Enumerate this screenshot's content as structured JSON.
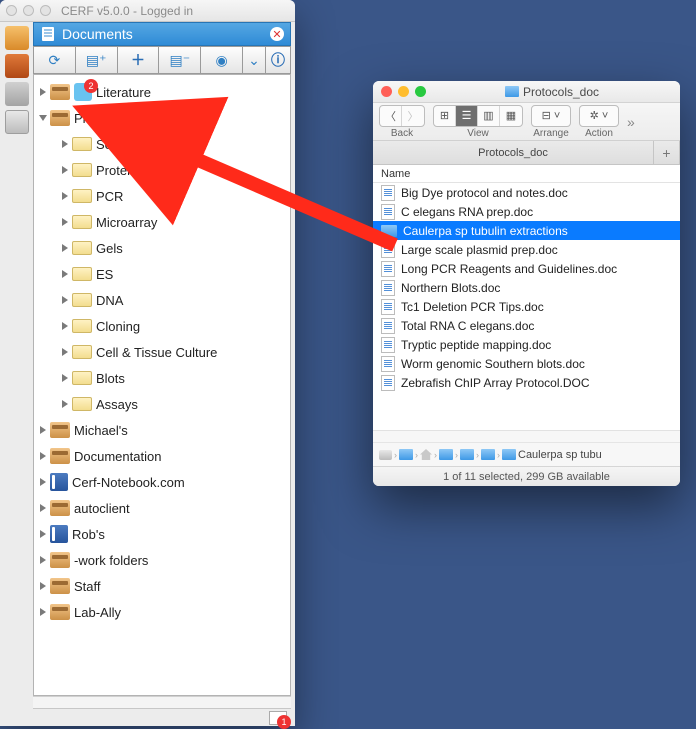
{
  "cerf": {
    "title": "CERF v5.0.0 - Logged in",
    "panel_title": "Documents",
    "literature_badge": "2",
    "tree": [
      {
        "type": "cabinet",
        "label": "Literature",
        "hasBadge": true
      },
      {
        "type": "cabinet",
        "label": "Protocols",
        "open": true
      },
      {
        "type": "folder",
        "label": "Sequencing",
        "child": true,
        "obscured": true
      },
      {
        "type": "folder",
        "label": "Protein",
        "child": true
      },
      {
        "type": "folder",
        "label": "PCR",
        "child": true
      },
      {
        "type": "folder",
        "label": "Microarray",
        "child": true
      },
      {
        "type": "folder",
        "label": "Gels",
        "child": true
      },
      {
        "type": "folder",
        "label": "ES",
        "child": true
      },
      {
        "type": "folder",
        "label": "DNA",
        "child": true
      },
      {
        "type": "folder",
        "label": "Cloning",
        "child": true
      },
      {
        "type": "folder",
        "label": "Cell & Tissue Culture",
        "child": true
      },
      {
        "type": "folder",
        "label": "Blots",
        "child": true
      },
      {
        "type": "folder",
        "label": "Assays",
        "child": true
      },
      {
        "type": "cabinet",
        "label": "Michael's"
      },
      {
        "type": "cabinet",
        "label": "Documentation"
      },
      {
        "type": "notebook",
        "label": "Cerf-Notebook.com"
      },
      {
        "type": "cabinet",
        "label": "autoclient"
      },
      {
        "type": "notebook",
        "label": "Rob's"
      },
      {
        "type": "cabinet",
        "label": "-work folders"
      },
      {
        "type": "cabinet",
        "label": "Staff"
      },
      {
        "type": "cabinet",
        "label": "Lab-Ally"
      }
    ],
    "status_badge": "1"
  },
  "finder": {
    "title": "Protocols_doc",
    "back": "Back",
    "view": "View",
    "arrange": "Arrange",
    "action": "Action",
    "tab": "Protocols_doc",
    "col": "Name",
    "files": [
      "Big Dye protocol and notes.doc",
      "C elegans RNA prep.doc",
      "Caulerpa sp tubulin extractions",
      "Large scale plasmid prep.doc",
      "Long PCR Reagents and Guidelines.doc",
      "Northern Blots.doc",
      "Tc1 Deletion PCR Tips.doc",
      "Total RNA C elegans.doc",
      "Tryptic peptide mapping.doc",
      "Worm genomic Southern blots.doc",
      "Zebrafish ChIP Array Protocol.DOC"
    ],
    "selected_index": 2,
    "path_last": "Caulerpa sp tubu",
    "status": "1 of 11 selected, 299 GB available"
  }
}
